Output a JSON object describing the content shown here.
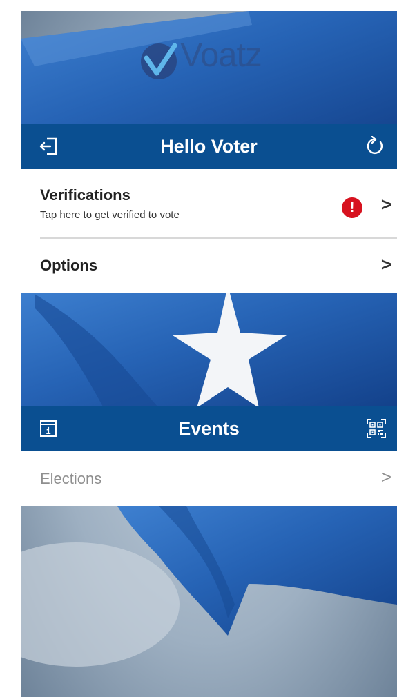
{
  "app": {
    "logo_text": "Voatz"
  },
  "header": {
    "title": "Hello Voter",
    "exit_icon": "logout-icon",
    "refresh_icon": "refresh-icon"
  },
  "menu": {
    "verifications": {
      "title": "Verifications",
      "subtitle": "Tap here to get verified to vote",
      "alert_icon": "alert-icon",
      "alert_symbol": "!"
    },
    "options": {
      "title": "Options"
    }
  },
  "events_header": {
    "title": "Events",
    "info_icon": "info-icon",
    "qr_icon": "qr-code-icon"
  },
  "events": {
    "elections": {
      "title": "Elections"
    }
  },
  "chevron": ">",
  "colors": {
    "primary": "#0a4f91",
    "alert": "#d7121f",
    "background": "#9fb1c4"
  }
}
